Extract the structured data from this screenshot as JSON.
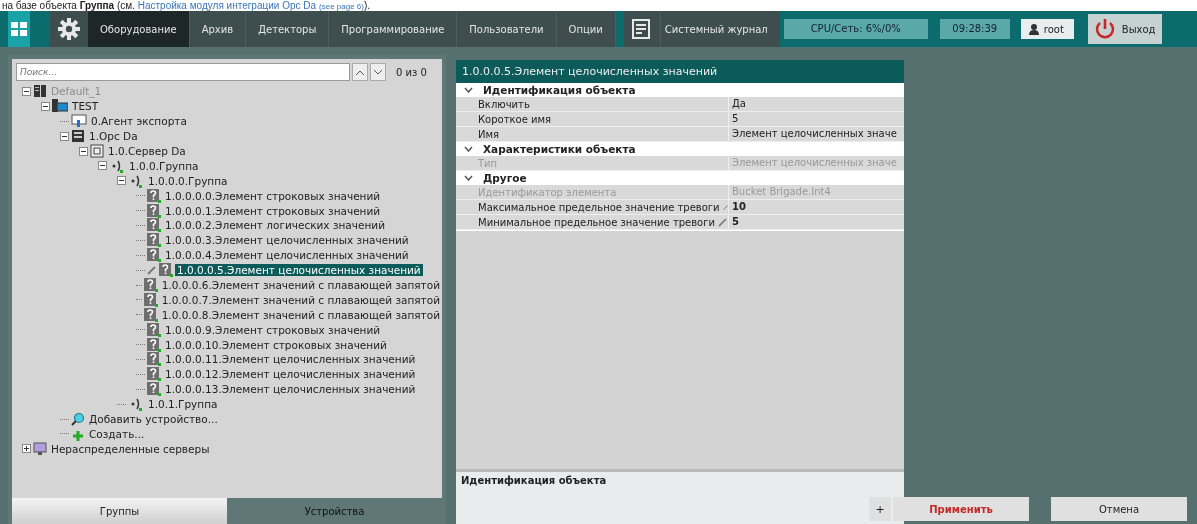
{
  "caption": {
    "text": "на базе объекта **Группа** (см. ",
    "link": "Настройка модуля интеграции Opc Da",
    "ref": "(see page 6)",
    "tail": ")."
  },
  "toolbar": {
    "tabs": [
      {
        "label": "Оборудование",
        "selected": true
      },
      {
        "label": "Архив",
        "selected": false
      },
      {
        "label": "Детекторы",
        "selected": false
      },
      {
        "label": "Программирование",
        "selected": false
      },
      {
        "label": "Пользователи",
        "selected": false
      },
      {
        "label": "Опции",
        "selected": false
      }
    ],
    "journal": "Системный журнал",
    "cpu": "CPU/Сеть: 6%/0%",
    "time": "09:28:39",
    "user": "root",
    "exit": "Выход"
  },
  "search": {
    "placeholder": "Поиск...",
    "count": "0 из 0"
  },
  "tree": [
    {
      "label": "Default_1",
      "kind": "server",
      "expanded": true,
      "disabled": true,
      "selected": false,
      "children": [
        {
          "label": "TEST",
          "kind": "computer",
          "expanded": true,
          "disabled": false,
          "selected": false,
          "children": [
            {
              "label": "0.Агент экспорта",
              "kind": "agent",
              "disabled": false,
              "selected": false
            },
            {
              "label": "1.Opc Da",
              "kind": "module",
              "expanded": true,
              "disabled": false,
              "selected": false,
              "children": [
                {
                  "label": "1.0.Сервер Da",
                  "kind": "device",
                  "expanded": true,
                  "disabled": false,
                  "selected": false,
                  "children": [
                    {
                      "label": "1.0.0.Группа",
                      "kind": "group",
                      "expanded": true,
                      "disabled": false,
                      "selected": false,
                      "children": [
                        {
                          "label": "1.0.0.0.Группа",
                          "kind": "group",
                          "expanded": true,
                          "disabled": false,
                          "selected": false,
                          "children": [
                            {
                              "label": "1.0.0.0.0.Элемент строковых значений",
                              "kind": "element",
                              "disabled": false,
                              "selected": false
                            },
                            {
                              "label": "1.0.0.0.1.Элемент строковых значений",
                              "kind": "element",
                              "disabled": false,
                              "selected": false
                            },
                            {
                              "label": "1.0.0.0.2.Элемент логических значений",
                              "kind": "element",
                              "disabled": false,
                              "selected": false
                            },
                            {
                              "label": "1.0.0.0.3.Элемент целочисленных значений",
                              "kind": "element",
                              "disabled": false,
                              "selected": false
                            },
                            {
                              "label": "1.0.0.0.4.Элемент целочисленных значений",
                              "kind": "element",
                              "disabled": false,
                              "selected": false
                            },
                            {
                              "label": "1.0.0.0.5.Элемент целочисленных значений",
                              "kind": "element",
                              "disabled": false,
                              "selected": true
                            },
                            {
                              "label": "1.0.0.0.6.Элемент значений с плавающей запятой",
                              "kind": "element",
                              "disabled": false,
                              "selected": false
                            },
                            {
                              "label": "1.0.0.0.7.Элемент значений с плавающей запятой",
                              "kind": "element",
                              "disabled": false,
                              "selected": false
                            },
                            {
                              "label": "1.0.0.0.8.Элемент значений с плавающей запятой",
                              "kind": "element",
                              "disabled": false,
                              "selected": false
                            },
                            {
                              "label": "1.0.0.0.9.Элемент строковых значений",
                              "kind": "element",
                              "disabled": false,
                              "selected": false
                            },
                            {
                              "label": "1.0.0.0.10.Элемент строковых значений",
                              "kind": "element",
                              "disabled": false,
                              "selected": false
                            },
                            {
                              "label": "1.0.0.0.11.Элемент целочисленных значений",
                              "kind": "element",
                              "disabled": false,
                              "selected": false
                            },
                            {
                              "label": "1.0.0.0.12.Элемент целочисленных значений",
                              "kind": "element",
                              "disabled": false,
                              "selected": false
                            },
                            {
                              "label": "1.0.0.0.13.Элемент целочисленных значений",
                              "kind": "element",
                              "disabled": false,
                              "selected": false
                            }
                          ]
                        },
                        {
                          "label": "1.0.1.Группа",
                          "kind": "group",
                          "disabled": false,
                          "selected": false
                        }
                      ]
                    }
                  ]
                }
              ]
            },
            {
              "label": "Добавить устройство...",
              "kind": "search",
              "disabled": false,
              "selected": false
            },
            {
              "label": "Создать...",
              "kind": "create",
              "disabled": false,
              "selected": false
            }
          ]
        }
      ]
    },
    {
      "label": "Нераспределенные серверы",
      "kind": "monitor",
      "expanded": false,
      "disabled": false,
      "selected": false
    }
  ],
  "bottom_tabs": [
    {
      "label": "Группы",
      "selected": false
    },
    {
      "label": "Устройства",
      "selected": true
    }
  ],
  "properties": {
    "title": "1.0.0.0.5.Элемент целочисленных значений",
    "sections": [
      {
        "title": "Идентификация объекта",
        "expanded": true,
        "rows": [
          {
            "name": "Включить",
            "value": "Да",
            "disabled": false,
            "edited": false
          },
          {
            "name": "Короткое имя",
            "value": "5",
            "disabled": false,
            "edited": false
          },
          {
            "name": "Имя",
            "value": "Элемент целочисленных значе",
            "disabled": false,
            "edited": false
          }
        ]
      },
      {
        "title": "Характеристики объекта",
        "expanded": true,
        "rows": [
          {
            "name": "Тип",
            "value": "Элемент целочисленных значе",
            "disabled": true,
            "edited": false
          }
        ]
      },
      {
        "title": "Другое",
        "expanded": true,
        "rows": [
          {
            "name": "Идентификатор элемента",
            "value": "Bucket Brigade.Int4",
            "disabled": true,
            "edited": false
          },
          {
            "name": "Максимальное предельное значение тревоги",
            "value": "10",
            "disabled": false,
            "edited": true
          },
          {
            "name": "Минимальное предельное значение тревоги",
            "value": "5",
            "disabled": false,
            "edited": true
          }
        ]
      }
    ],
    "description": "Идентификация объекта"
  },
  "buttons": {
    "add": "+",
    "apply": "Применить",
    "cancel": "Отмена"
  }
}
